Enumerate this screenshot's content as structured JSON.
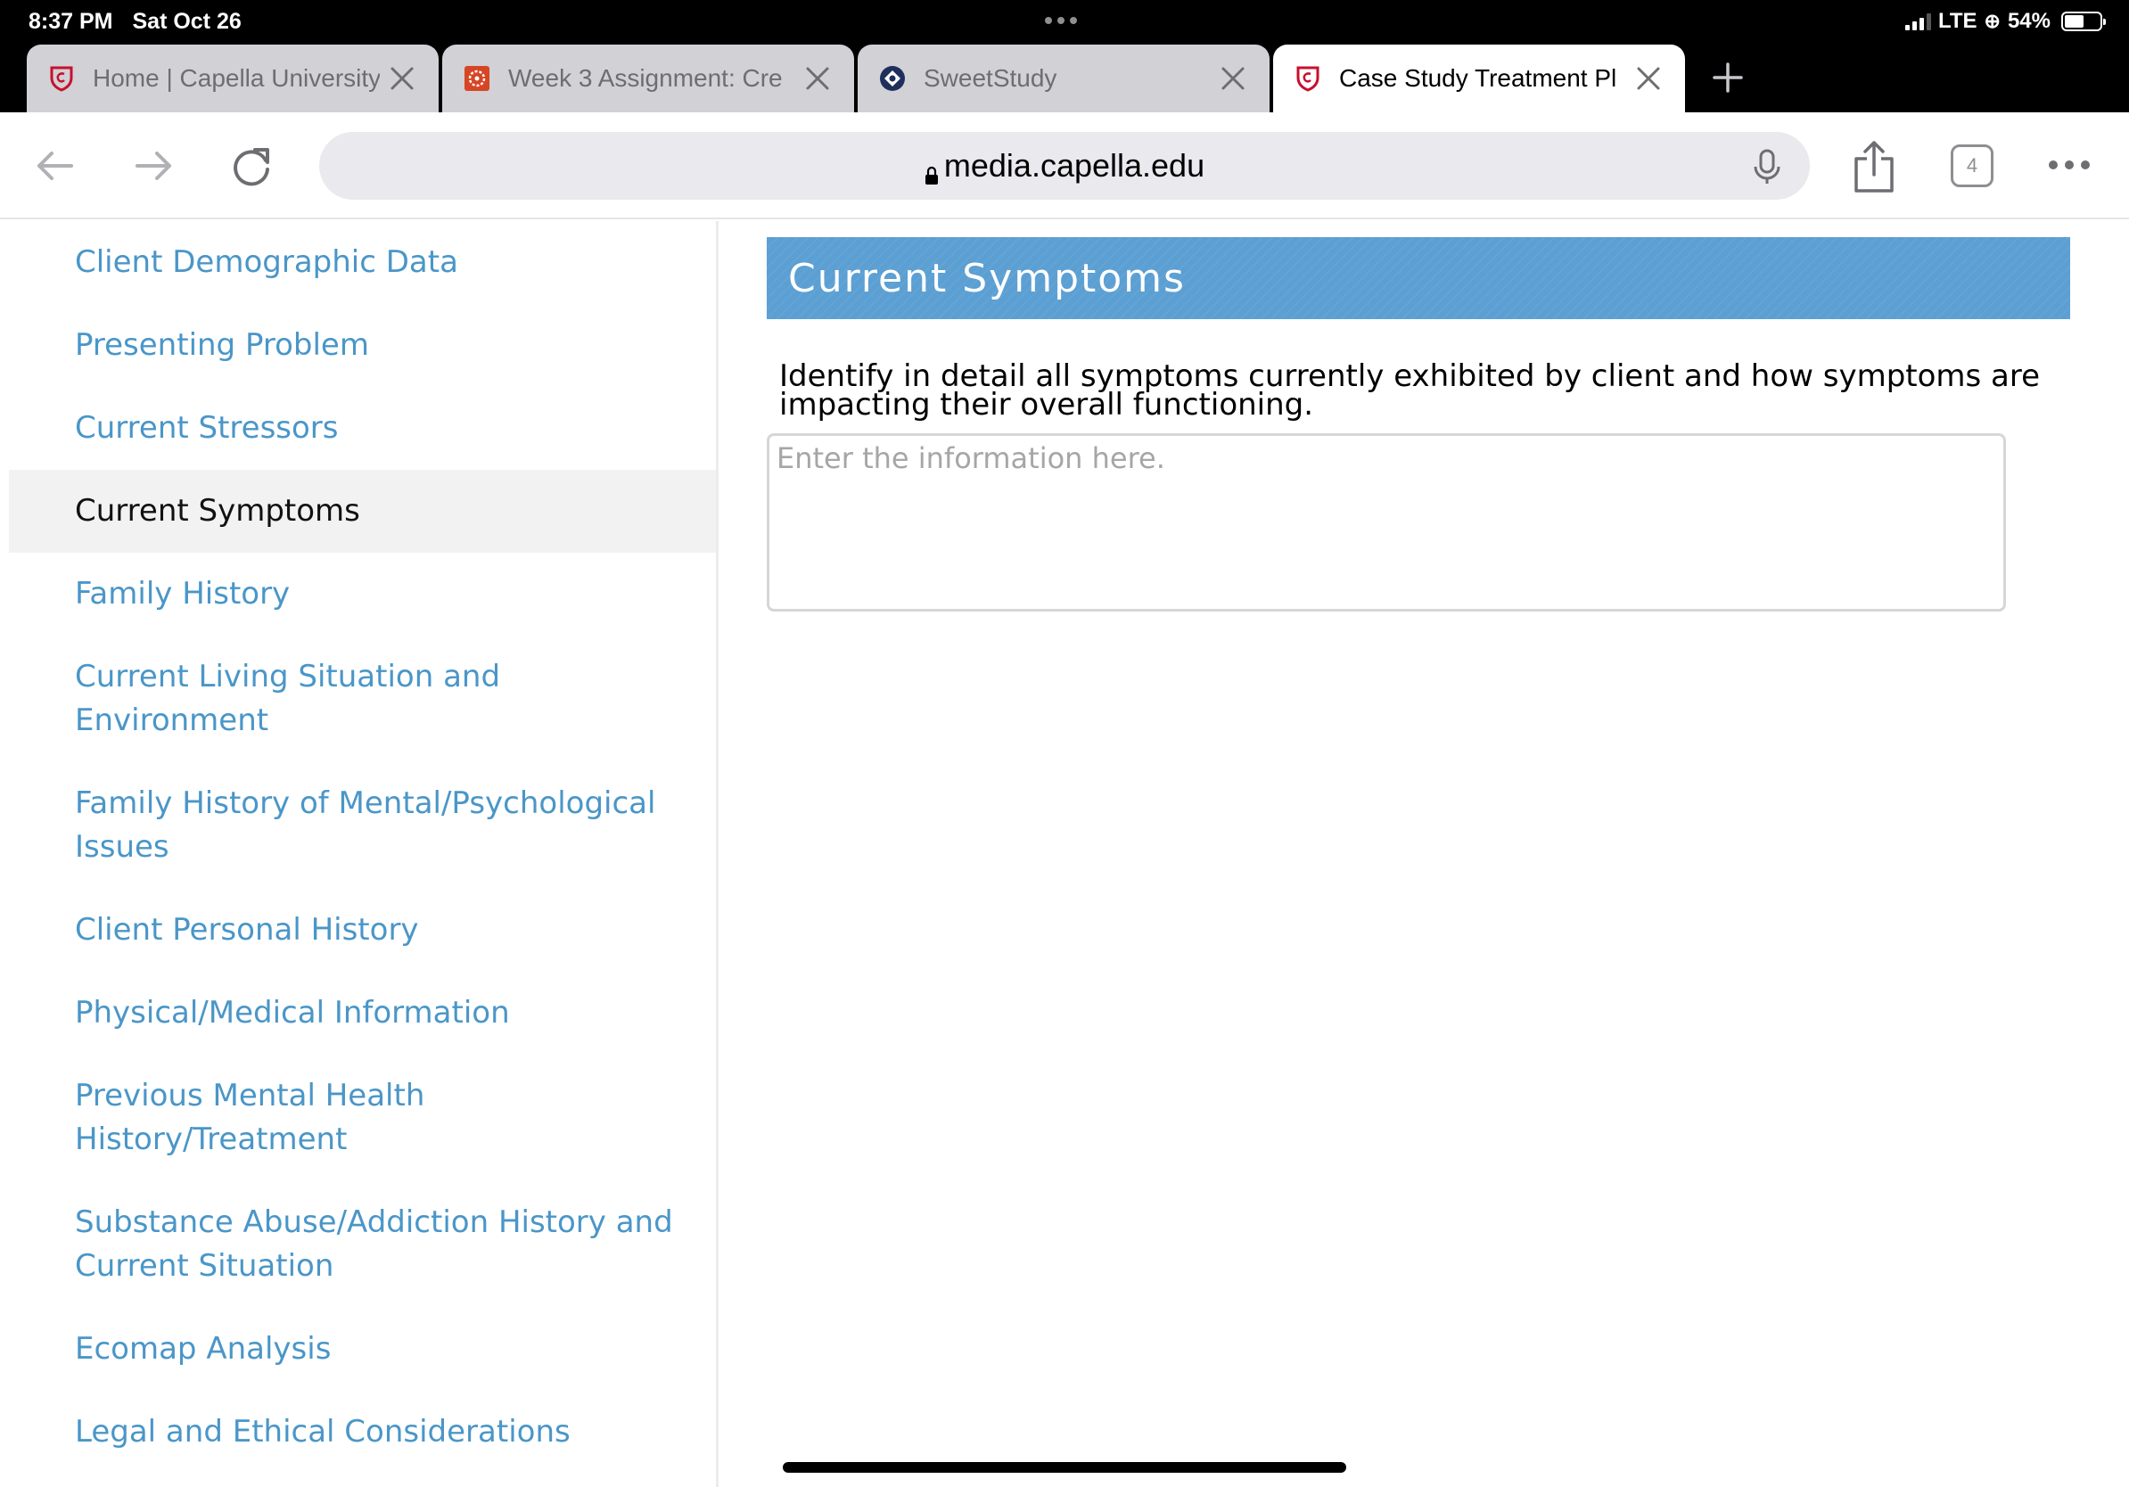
{
  "status_bar": {
    "time": "8:37 PM",
    "date": "Sat Oct 26",
    "network": "LTE",
    "battery": "54%",
    "battery_level": 0.54
  },
  "tabs": [
    {
      "title": "Home | Capella University",
      "favicon": "capella-shield-icon",
      "active": false
    },
    {
      "title": "Week 3 Assignment: Cre",
      "favicon": "canvas-logo-icon",
      "active": false
    },
    {
      "title": "SweetStudy",
      "favicon": "sweetstudy-logo-icon",
      "active": false
    },
    {
      "title": "Case Study Treatment Pl",
      "favicon": "capella-shield-icon",
      "active": true
    }
  ],
  "address_bar": {
    "url": "media.capella.edu",
    "tab_count": "4"
  },
  "sidebar": {
    "items": [
      {
        "label": "Client Demographic Data",
        "active": false
      },
      {
        "label": "Presenting Problem",
        "active": false
      },
      {
        "label": "Current Stressors",
        "active": false
      },
      {
        "label": "Current Symptoms",
        "active": true
      },
      {
        "label": "Family History",
        "active": false
      },
      {
        "label": "Current Living Situation and Environment",
        "active": false
      },
      {
        "label": "Family History of Mental/Psychological Issues",
        "active": false
      },
      {
        "label": "Client Personal History",
        "active": false
      },
      {
        "label": "Physical/Medical Information",
        "active": false
      },
      {
        "label": "Previous Mental Health History/Treatment",
        "active": false
      },
      {
        "label": "Substance Abuse/Addiction History and Current Situation",
        "active": false
      },
      {
        "label": "Ecomap Analysis",
        "active": false
      },
      {
        "label": "Legal and Ethical Considerations",
        "active": false
      }
    ]
  },
  "main": {
    "section_title": "Current Symptoms",
    "instructions": "Identify in detail all symptoms currently exhibited by client and how symptoms are impacting their overall functioning.",
    "answer_value": "",
    "answer_placeholder": "Enter the information here."
  },
  "colors": {
    "link": "#4a96c8",
    "banner": "#5b9fd3",
    "active_nav_bg": "#f2f2f2",
    "capella_red": "#c8102e"
  }
}
